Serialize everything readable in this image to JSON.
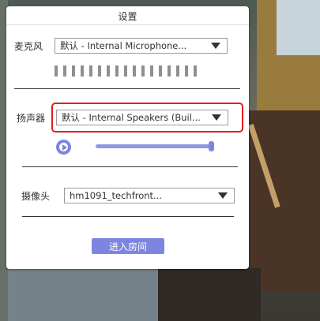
{
  "dialog": {
    "title": "设置",
    "microphone": {
      "label": "麦克风",
      "selected": "默认 - Internal Microphone...",
      "level_meter_bars": 17
    },
    "speaker": {
      "label": "扬声器",
      "selected": "默认 - Internal Speakers (Buil...",
      "volume": 1.0
    },
    "camera": {
      "label": "摄像头",
      "selected": "hm1091_techfront..."
    },
    "enter_button": "进入房间"
  },
  "colors": {
    "accent": "#7c86e0",
    "highlight": "#e01e1e"
  }
}
